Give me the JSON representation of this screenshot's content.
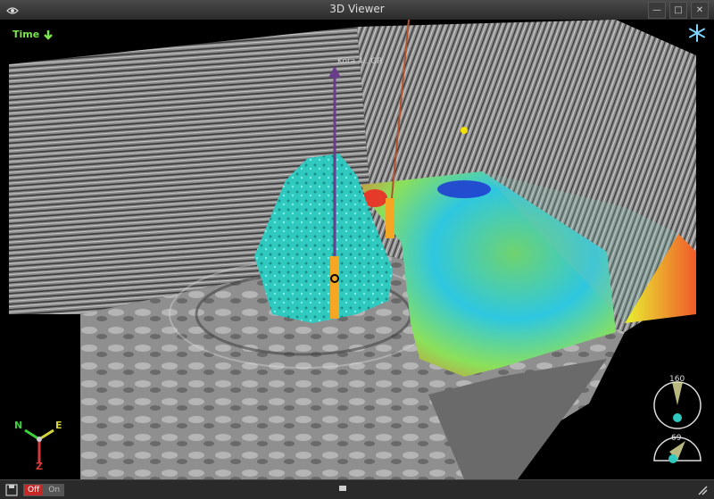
{
  "window": {
    "title": "3D Viewer"
  },
  "toolbar": {
    "time_label": "Time",
    "time_icon": "arrow-down-icon",
    "freeze_icon": "snowflake-icon"
  },
  "scene": {
    "well_label": "Kora 4 . GR"
  },
  "compass": {
    "north": "N",
    "east": "E",
    "zenith": "Z"
  },
  "dials": {
    "azimuth": "160",
    "inclination": "69"
  },
  "statusbar": {
    "off_label": "Off",
    "on_label": "On"
  },
  "colors": {
    "accent_green": "#7be34d",
    "geobody": "#2fc9c0",
    "well_purple": "#6a3d8c",
    "well_orange": "#b5522b"
  }
}
